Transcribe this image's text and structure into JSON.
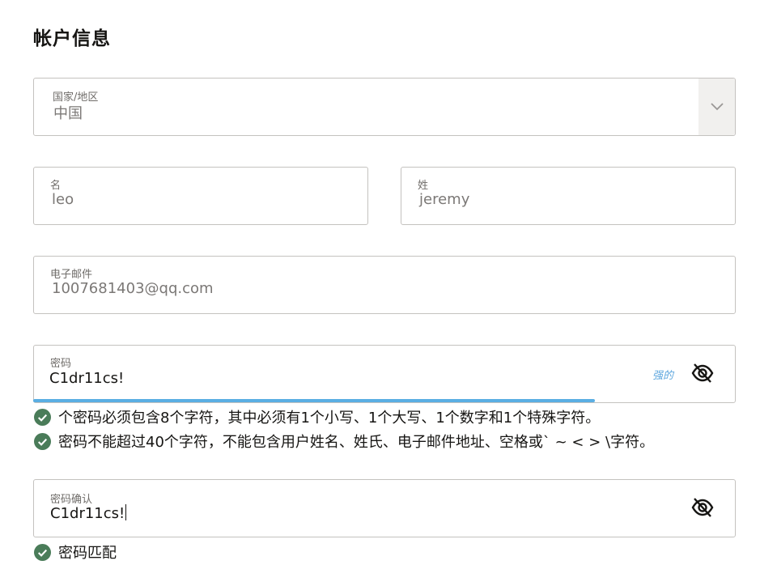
{
  "section": {
    "title": "帐户信息"
  },
  "country": {
    "label": "国家/地区",
    "value": "中国",
    "chevron_icon": "chevron-down-icon"
  },
  "first_name": {
    "label": "名",
    "value": "leo"
  },
  "last_name": {
    "label": "姓",
    "value": "jeremy"
  },
  "email": {
    "label": "电子邮件",
    "value": "1007681403@qq.com"
  },
  "password": {
    "label": "密码",
    "value": "C1dr11cs!",
    "strength": "强的",
    "strength_level": 0.8,
    "toggle_icon": "eye-slash-icon"
  },
  "password_rules": [
    {
      "text": "个密码必须包含8个字符，其中必须有1个小写、1个大写、1个数字和1个特殊字符。",
      "icon": "check-circle-icon"
    },
    {
      "text": "密码不能超过40个字符，不能包含用户姓名、姓氏、电子邮件地址、空格或` ~ < > \\字符。",
      "icon": "check-circle-icon"
    }
  ],
  "confirm_password": {
    "label": "密码确认",
    "value": "C1dr11cs!",
    "toggle_icon": "eye-slash-icon",
    "match_text": "密码匹配"
  },
  "colors": {
    "check": "#4a7c59",
    "strength": "#5ea7de",
    "border": "#c4c2bf"
  }
}
